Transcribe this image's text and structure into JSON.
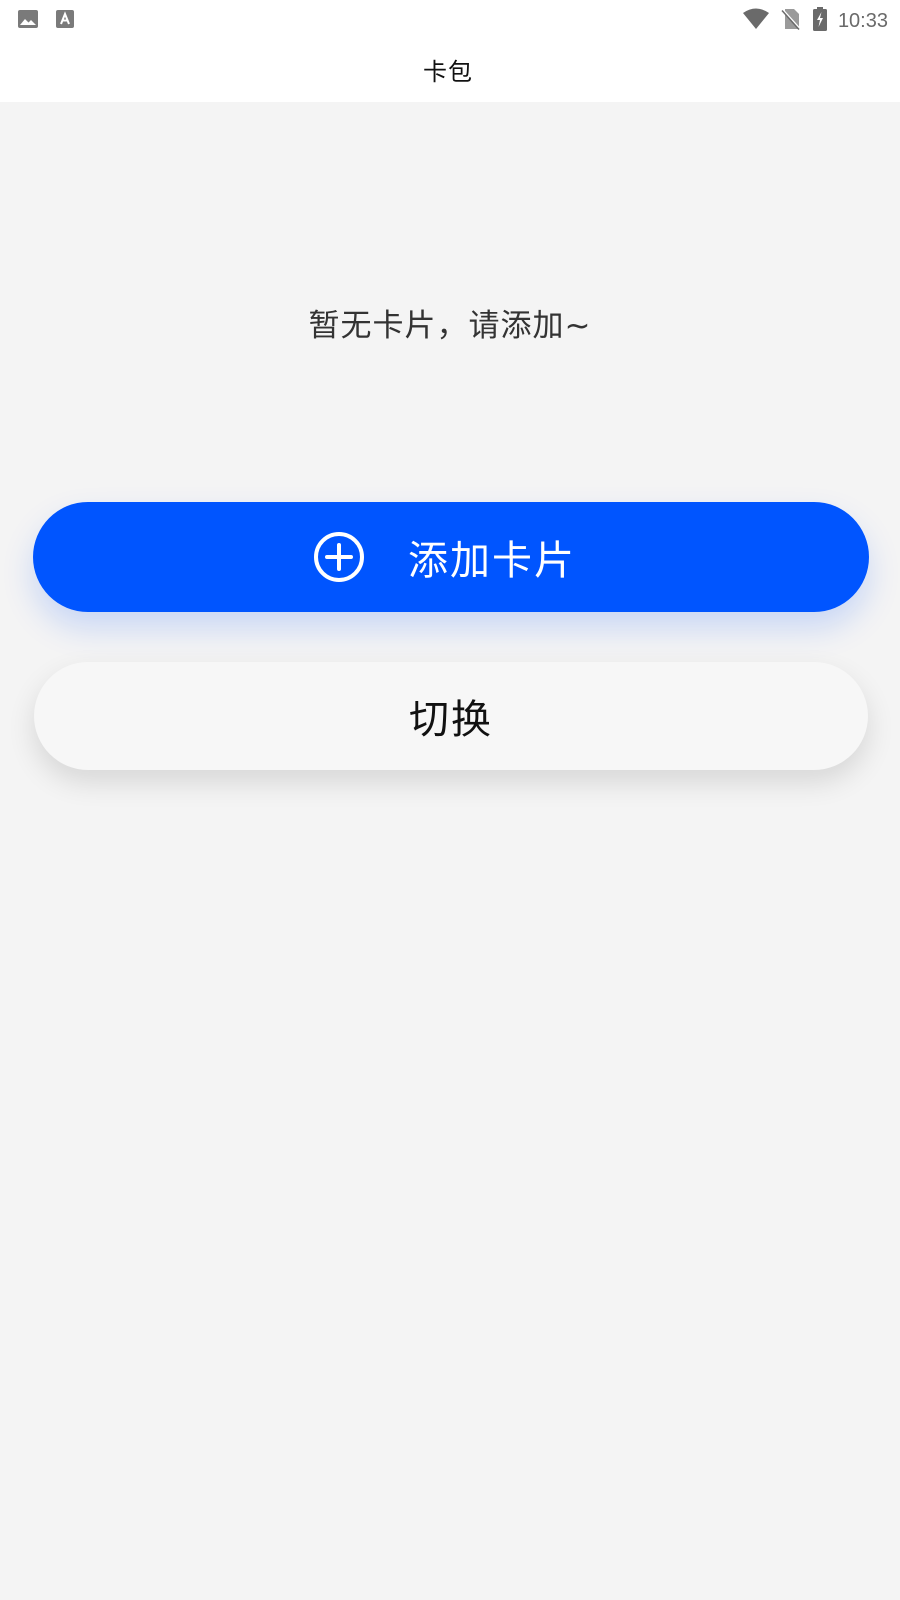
{
  "status_bar": {
    "time": "10:33",
    "left_icons": [
      "image-icon",
      "text-recognition-icon"
    ],
    "right_icons": [
      "wifi-icon",
      "no-sim-icon",
      "battery-charging-icon"
    ]
  },
  "app_bar": {
    "title": "卡包"
  },
  "main": {
    "empty_message": "暂无卡片，请添加~",
    "add_card_button": {
      "label": "添加卡片",
      "icon": "plus-circle-icon",
      "color": "#0055ff"
    },
    "switch_button": {
      "label": "切换",
      "color": "#f7f7f7"
    }
  }
}
